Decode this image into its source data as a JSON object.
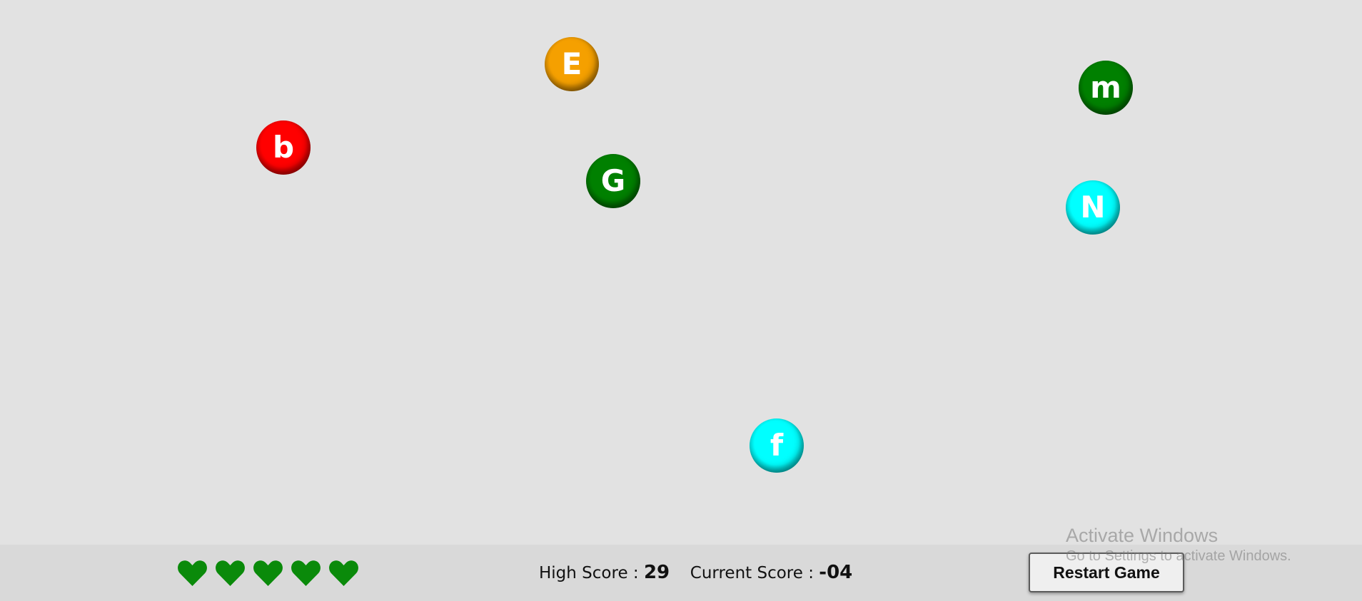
{
  "balls": [
    {
      "letter": "E",
      "color": "#f5a000"
    },
    {
      "letter": "b",
      "color": "#ff0000"
    },
    {
      "letter": "G",
      "color": "#008000"
    },
    {
      "letter": "m",
      "color": "#008000"
    },
    {
      "letter": "N",
      "color": "#00ffff"
    },
    {
      "letter": "f",
      "color": "#00ffff"
    }
  ],
  "lives": {
    "count": 5,
    "icon": "heart-icon",
    "color": "#0a8a0a"
  },
  "scores": {
    "high_label": "High Score :",
    "high_value": "29",
    "current_label": "Current Score :",
    "current_value": "-04"
  },
  "restart": {
    "label": "Restart Game"
  },
  "watermark": {
    "title": "Activate Windows",
    "subtitle": "Go to Settings to activate Windows."
  },
  "colors": {
    "background": "#e2e2e2",
    "bottom_bar": "#d9d9d9"
  }
}
